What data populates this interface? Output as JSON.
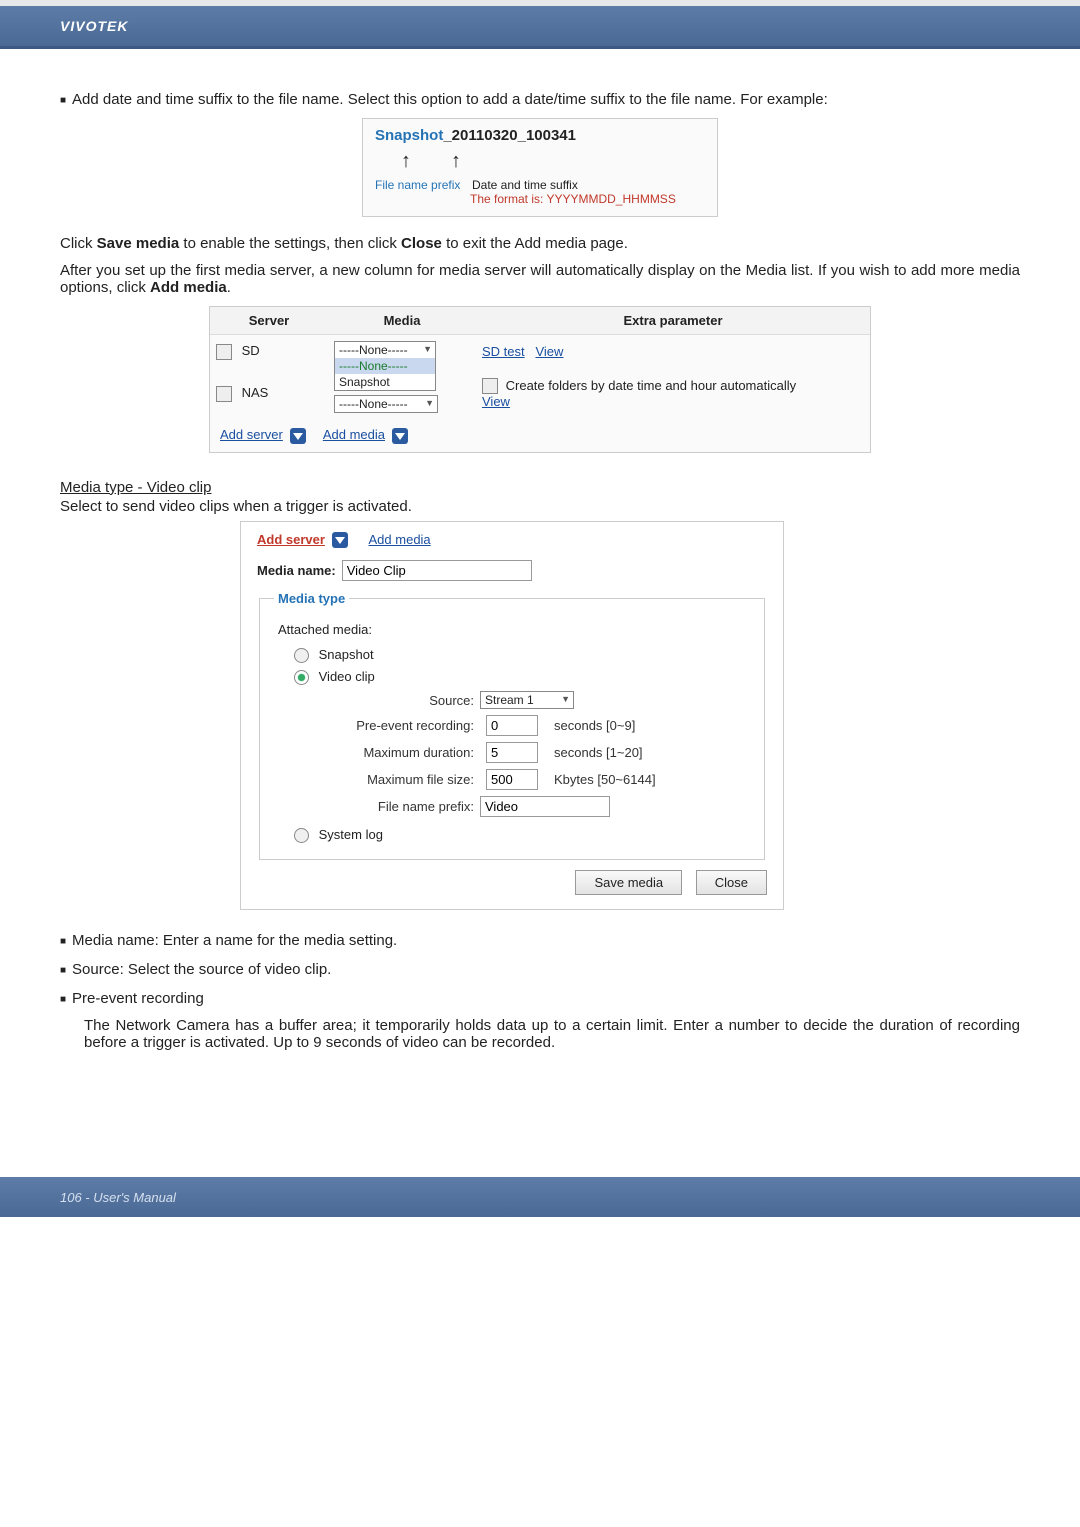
{
  "header": {
    "brand": "VIVOTEK"
  },
  "bullet1": {
    "text": "Add date and time suffix to the file name. Select this option to add a date/time suffix to the file name. For example:"
  },
  "illus1": {
    "prefix_colored": "Snapshot",
    "suffix_black": "_20110320_100341",
    "file_name_prefix_label": "File name prefix",
    "dts_label": "Date and time suffix",
    "format_label": "The format is: YYYYMMDD_HHMMSS"
  },
  "para_save": {
    "p1a": "Click ",
    "p1b": "Save media",
    "p1c": " to enable the settings, then click ",
    "p1d": "Close",
    "p1e": " to exit the Add media page."
  },
  "para_after": "After you set up the first media server, a new column for media server will automatically display on the Media list. If you wish to add more media options, click ",
  "para_after_bold": "Add media",
  "para_after_end": ".",
  "panel": {
    "th_server": "Server",
    "th_media": "Media",
    "th_extra": "Extra parameter",
    "row1": {
      "server": "SD",
      "media_selected": "-----None-----",
      "media_options": [
        "-----None-----",
        "Snapshot"
      ],
      "sd_test": "SD test",
      "view": "View"
    },
    "row2": {
      "server": "NAS",
      "media_selected": "-----None-----",
      "create_folders": "Create folders by date time and hour automatically",
      "view": "View"
    },
    "add_server": "Add server",
    "add_media": "Add media"
  },
  "section_title": "Media type - Video clip",
  "section_sub": "Select to send video clips when a trigger is activated.",
  "dialog": {
    "add_server": "Add server",
    "add_media": "Add media",
    "media_name_label": "Media name:",
    "media_name_value": "Video Clip",
    "legend": "Media type",
    "attached_media": "Attached media:",
    "opt_snapshot": "Snapshot",
    "opt_videoclip": "Video clip",
    "opt_systemlog": "System log",
    "source_label": "Source:",
    "source_value": "Stream 1",
    "pre_label": "Pre-event recording:",
    "pre_value": "0",
    "pre_hint": "seconds [0~9]",
    "maxdur_label": "Maximum duration:",
    "maxdur_value": "5",
    "maxdur_hint": "seconds [1~20]",
    "maxfs_label": "Maximum file size:",
    "maxfs_value": "500",
    "maxfs_hint": "Kbytes [50~6144]",
    "fnp_label": "File name prefix:",
    "fnp_value": "Video",
    "btn_save": "Save media",
    "btn_close": "Close"
  },
  "bullets_bottom": {
    "b1": "Media name: Enter a name for the media setting.",
    "b2": "Source: Select the source of video clip.",
    "b3": "Pre-event recording",
    "b3_text": "The Network Camera has a buffer area; it temporarily holds data up to a certain limit. Enter a number to decide the duration of recording before a trigger is activated. Up to 9 seconds of video can be recorded."
  },
  "footer": {
    "page": "106 - User's Manual"
  }
}
